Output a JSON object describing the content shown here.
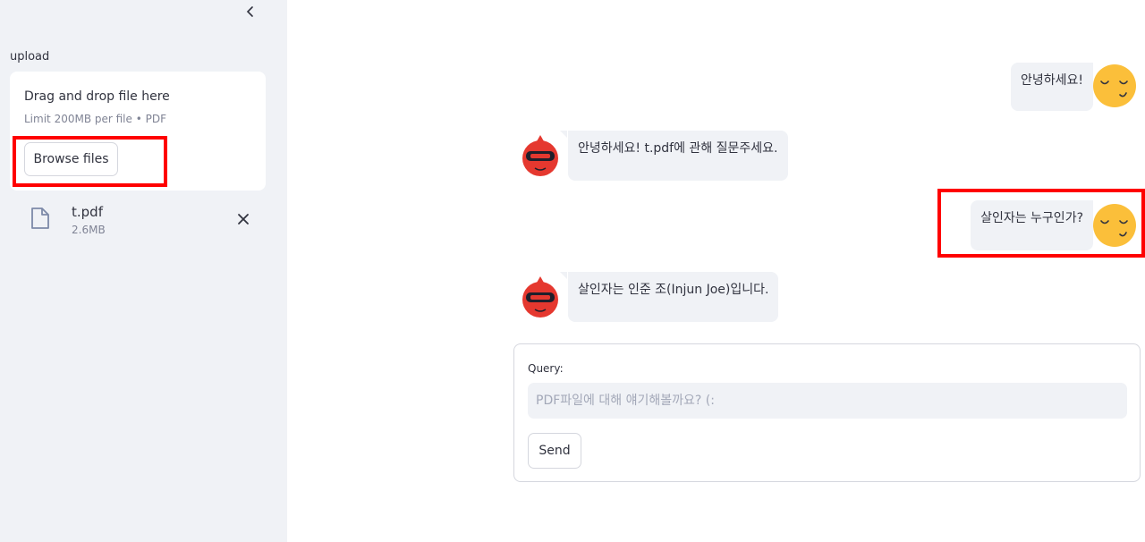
{
  "sidebar": {
    "upload_label": "upload",
    "dropzone": {
      "title": "Drag and drop file here",
      "limit": "Limit 200MB per file • PDF",
      "browse_label": "Browse files"
    },
    "file": {
      "name": "t.pdf",
      "size": "2.6MB",
      "icon": "file-icon",
      "delete_icon": "close-icon"
    },
    "collapse_icon": "chevron-left-icon"
  },
  "chat": {
    "messages": [
      {
        "role": "user",
        "text": "안녕하세요!"
      },
      {
        "role": "assistant",
        "text": "안녕하세요! t.pdf에 관해 질문주세요."
      },
      {
        "role": "user",
        "text": "살인자는 누구인가?"
      },
      {
        "role": "assistant",
        "text": "살인자는 인준 조(Injun Joe)입니다."
      }
    ]
  },
  "form": {
    "query_label": "Query:",
    "query_value": "",
    "query_placeholder": "PDF파일에 대해 얘기해볼까요? (:",
    "send_label": "Send"
  },
  "colors": {
    "sidebar_bg": "#f0f2f6",
    "bubble_bg": "#f0f2f6",
    "highlight": "#ff0000",
    "user_avatar": "#fbbf3a",
    "bot_avatar": "#e5382f"
  }
}
